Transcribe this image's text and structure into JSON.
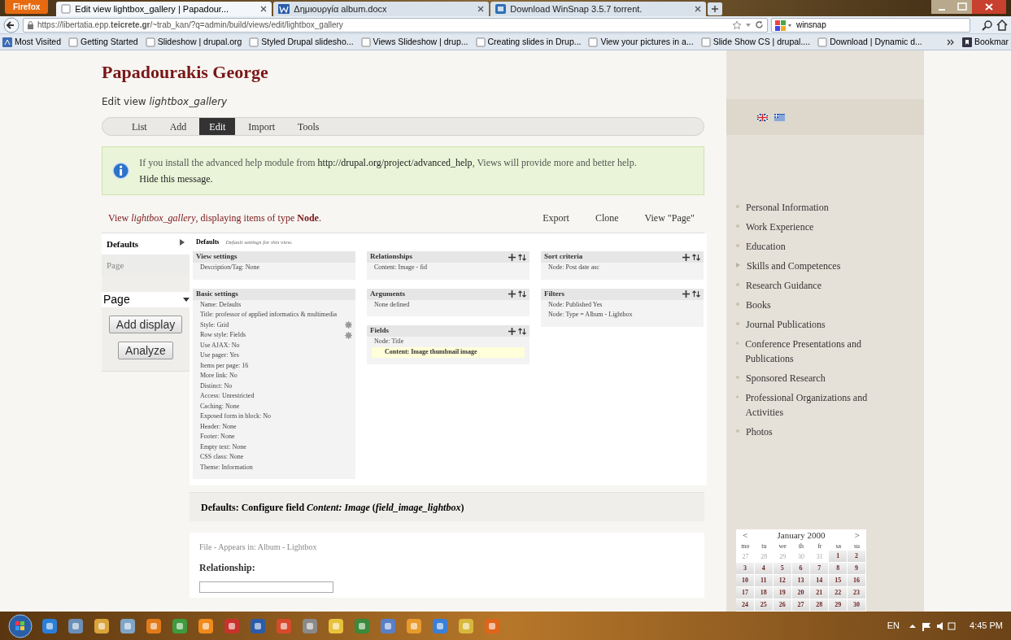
{
  "browser": {
    "app_button": "Firefox",
    "tabs": [
      {
        "title": "Edit view lightbox_gallery | Papadour...",
        "selected": true
      },
      {
        "title": "Δημιουργία album.docx",
        "selected": false
      },
      {
        "title": "Download WinSnap 3.5.7 torrent.",
        "selected": false
      }
    ],
    "url": "https://libertatia.epp.**teicrete.gr**/~trab_kan/?q=admin/build/views/edit/lightbox_gallery",
    "search": "winsnap",
    "bookmarks": [
      "Most Visited",
      "Getting Started",
      "Slideshow | drupal.org",
      "Styled Drupal slidesho...",
      "Views Slideshow | drup...",
      "Creating slides in Drup...",
      "View your pictures in a...",
      "Slide Show CS | drupal....",
      "Download | Dynamic d..."
    ],
    "bookmarks_menu": "Bookmar"
  },
  "page": {
    "site_title": "Papadourakis George",
    "subtitle": "Edit view *lightbox_gallery*",
    "tabs": [
      {
        "label": "List",
        "selected": false
      },
      {
        "label": "Add",
        "selected": false
      },
      {
        "label": "Edit",
        "selected": true
      },
      {
        "label": "Import",
        "selected": false
      },
      {
        "label": "Tools",
        "selected": false
      }
    ],
    "help": {
      "before": "If you install the advanced help module from ",
      "link": "http://drupal.org/project/advanced_help",
      "after": ", Views will provide more and better help. ",
      "hide": "Hide this message."
    },
    "view_line": "View *lightbox_gallery*, displaying items of type **Node**.",
    "actions": [
      "Export",
      "Clone",
      "View \"Page\""
    ],
    "displays": [
      {
        "label": "Defaults",
        "selected": true
      },
      {
        "label": "Page",
        "selected": false
      }
    ],
    "display_select": "Page",
    "buttons": [
      "Add display",
      "Analyze"
    ],
    "display_title": "Defaults",
    "display_desc": "Default settings for this view.",
    "columns": [
      [
        {
          "title": "View settings",
          "actions": false,
          "items": [
            {
              "text": "Description/Tag: None",
              "kind": "text"
            }
          ]
        },
        {
          "title": "Basic settings",
          "actions": false,
          "items": [
            {
              "text": "Name: Defaults",
              "kind": "text"
            },
            {
              "text": "Title: professor of applied informatics & multimedia",
              "kind": "text"
            },
            {
              "text": "Style: Grid",
              "kind": "gear"
            },
            {
              "text": "Row style: Fields",
              "kind": "gear"
            },
            {
              "text": "Use AJAX: No",
              "kind": "text"
            },
            {
              "text": "Use pager: Yes",
              "kind": "text"
            },
            {
              "text": "Items per page: 16",
              "kind": "text"
            },
            {
              "text": "More link: No",
              "kind": "text"
            },
            {
              "text": "Distinct: No",
              "kind": "text"
            },
            {
              "text": "Access: Unrestricted",
              "kind": "text"
            },
            {
              "text": "Caching: None",
              "kind": "text"
            },
            {
              "text": "Exposed form in block: No",
              "kind": "text"
            },
            {
              "text": "Header: None",
              "kind": "text"
            },
            {
              "text": "Footer: None",
              "kind": "text"
            },
            {
              "text": "Empty text: None",
              "kind": "text"
            },
            {
              "text": "CSS class: None",
              "kind": "text"
            },
            {
              "text": "Theme: Information",
              "kind": "text"
            }
          ]
        }
      ],
      [
        {
          "title": "Relationships",
          "actions": true,
          "items": [
            {
              "text": "Content: Image - fid",
              "kind": "text"
            }
          ]
        },
        {
          "title": "Arguments",
          "actions": true,
          "items": [
            {
              "text": "None defined",
              "kind": "text"
            }
          ]
        },
        {
          "title": "Fields",
          "actions": true,
          "items": [
            {
              "text": "Node: Title",
              "kind": "text"
            },
            {
              "text": "Content: Image thumbnail image",
              "kind": "highlighted"
            }
          ]
        }
      ],
      [
        {
          "title": "Sort criteria",
          "actions": true,
          "items": [
            {
              "text": "Node: Post date asc",
              "kind": "text"
            }
          ]
        },
        {
          "title": "Filters",
          "actions": true,
          "items": [
            {
              "text": "Node: Published Yes",
              "kind": "text"
            },
            {
              "text": "Node: Type = Album - Lightbox",
              "kind": "text"
            }
          ]
        }
      ]
    ],
    "configure_title": "Defaults: Configure field *Content: Image* (*field_image_lightbox*)",
    "configure_note": "File - Appears in: Album - Lightbox",
    "relationship_label": "Relationship:"
  },
  "sidebar": {
    "menu": [
      {
        "label": "Personal Information",
        "kind": "bullet"
      },
      {
        "label": "Work Experience",
        "kind": "bullet"
      },
      {
        "label": "Education",
        "kind": "bullet"
      },
      {
        "label": "Skills and Competences",
        "kind": "arrow"
      },
      {
        "label": "Research Guidance",
        "kind": "bullet"
      },
      {
        "label": "Books",
        "kind": "bullet"
      },
      {
        "label": "Journal Publications",
        "kind": "bullet"
      },
      {
        "label": "Conference Presentations and Publications",
        "kind": "bullet"
      },
      {
        "label": "Sponsored Research",
        "kind": "bullet"
      },
      {
        "label": "Professional Organizations and Activities",
        "kind": "bullet"
      },
      {
        "label": "Photos",
        "kind": "bullet"
      }
    ],
    "calendar": {
      "prev": "<",
      "month": "January 2000",
      "next": ">",
      "weekdays": [
        "mo",
        "tu",
        "we",
        "th",
        "fr",
        "sa",
        "su"
      ],
      "weeks": [
        [
          {
            "day": "27",
            "other_month": true
          },
          {
            "day": "28",
            "other_month": true
          },
          {
            "day": "29",
            "other_month": true
          },
          {
            "day": "30",
            "other_month": true
          },
          {
            "day": "31",
            "other_month": true
          },
          {
            "day": "1",
            "other_month": false
          },
          {
            "day": "2",
            "other_month": false
          }
        ],
        [
          {
            "day": "3",
            "other_month": false
          },
          {
            "day": "4",
            "other_month": false
          },
          {
            "day": "5",
            "other_month": false
          },
          {
            "day": "6",
            "other_month": false
          },
          {
            "day": "7",
            "other_month": false
          },
          {
            "day": "8",
            "other_month": false
          },
          {
            "day": "9",
            "other_month": false
          }
        ],
        [
          {
            "day": "10",
            "other_month": false
          },
          {
            "day": "11",
            "other_month": false
          },
          {
            "day": "12",
            "other_month": false
          },
          {
            "day": "13",
            "other_month": false
          },
          {
            "day": "14",
            "other_month": false
          },
          {
            "day": "15",
            "other_month": false
          },
          {
            "day": "16",
            "other_month": false
          }
        ],
        [
          {
            "day": "17",
            "other_month": false
          },
          {
            "day": "18",
            "other_month": false
          },
          {
            "day": "19",
            "other_month": false
          },
          {
            "day": "20",
            "other_month": false
          },
          {
            "day": "21",
            "other_month": false
          },
          {
            "day": "22",
            "other_month": false
          },
          {
            "day": "23",
            "other_month": false
          }
        ],
        [
          {
            "day": "24",
            "other_month": false
          },
          {
            "day": "25",
            "other_month": false
          },
          {
            "day": "26",
            "other_month": false
          },
          {
            "day": "27",
            "other_month": false
          },
          {
            "day": "28",
            "other_month": false
          },
          {
            "day": "29",
            "other_month": false
          },
          {
            "day": "30",
            "other_month": false
          }
        ]
      ]
    }
  },
  "taskbar": {
    "language": "EN",
    "clock": "4:45 PM"
  }
}
